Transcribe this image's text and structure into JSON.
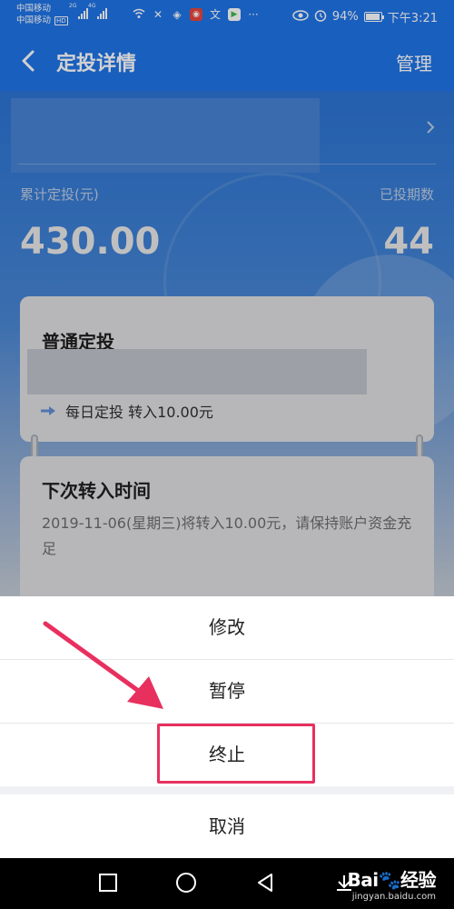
{
  "status_bar": {
    "carrier1": "中国移动",
    "carrier2": "中国移动",
    "hd": "HD",
    "net1": "2G",
    "net2": "4G",
    "ellipsis": "···",
    "battery_pct": "94%",
    "battery_level": 0.94,
    "time": "下午3:21"
  },
  "nav": {
    "title": "定投详情",
    "manage": "管理"
  },
  "summary": {
    "total_label": "累计定投(元)",
    "total_value": "430.00",
    "periods_label": "已投期数",
    "periods_value": "44"
  },
  "plan_card": {
    "title": "普通定投",
    "detail": "每日定投 转入10.00元"
  },
  "next_card": {
    "title": "下次转入时间",
    "desc": "2019-11-06(星期三)将转入10.00元，请保持账户资金充足"
  },
  "action_sheet": {
    "edit": "修改",
    "pause": "暂停",
    "stop": "终止",
    "cancel": "取消"
  },
  "watermark": {
    "logo": "Bai🐾经验",
    "url": "jingyan.baidu.com"
  },
  "colors": {
    "primary": "#1f74e8",
    "highlight": "#e8305f"
  }
}
